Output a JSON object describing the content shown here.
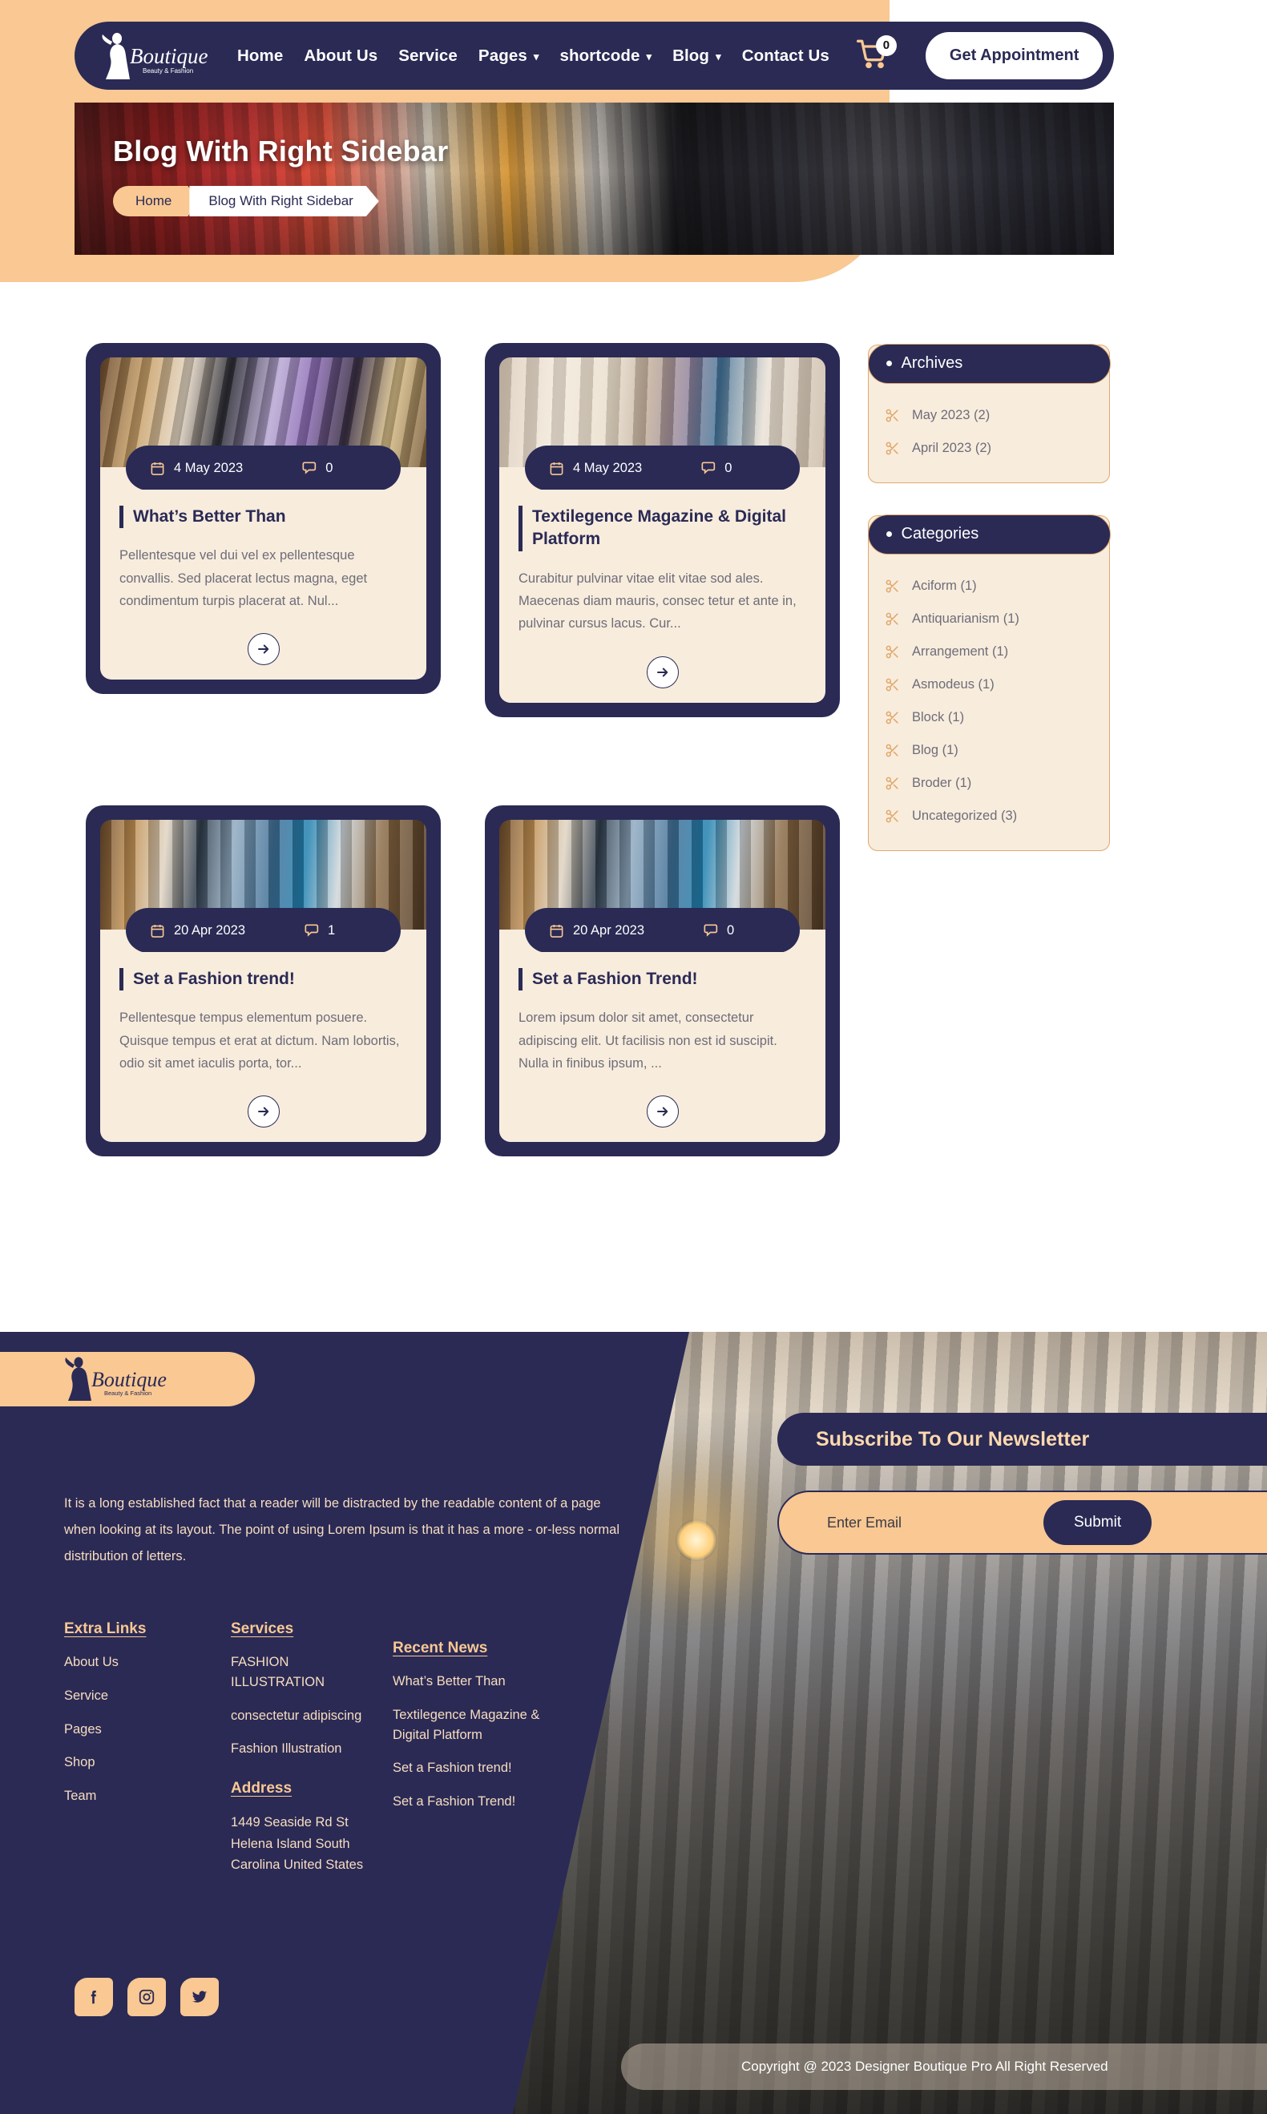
{
  "nav": {
    "brand": "Boutique",
    "brand_tagline": "Beauty & Fashion",
    "links": [
      {
        "label": "Home",
        "caret": false
      },
      {
        "label": "About Us",
        "caret": false
      },
      {
        "label": "Service",
        "caret": false
      },
      {
        "label": "Pages",
        "caret": true
      },
      {
        "label": "shortcode",
        "caret": true
      },
      {
        "label": "Blog",
        "caret": true
      },
      {
        "label": "Contact Us",
        "caret": false
      }
    ],
    "cart_count": "0",
    "cta": "Get Appointment"
  },
  "hero": {
    "title": "Blog With Right Sidebar",
    "crumb_home": "Home",
    "crumb_current": "Blog With Right Sidebar"
  },
  "posts": [
    {
      "date": "4 May 2023",
      "comments": "0",
      "title": "What’s Better Than",
      "excerpt": "Pellentesque vel dui vel ex pellentesque convallis. Sed placerat lectus magna, eget condimentum turpis placerat at. Nul..."
    },
    {
      "date": "4 May 2023",
      "comments": "0",
      "title": "Textilegence Magazine & Digital Platform",
      "excerpt": "Curabitur pulvinar vitae elit vitae sod ales. Maecenas diam mauris, consec tetur et ante in, pulvinar cursus lacus. Cur..."
    },
    {
      "date": "20 Apr 2023",
      "comments": "1",
      "title": "Set a Fashion trend!",
      "excerpt": "Pellentesque tempus elementum posuere. Quisque tempus et erat at dictum. Nam lobortis, odio sit amet iaculis porta, tor..."
    },
    {
      "date": "20 Apr 2023",
      "comments": "0",
      "title": "Set a Fashion Trend!",
      "excerpt": "Lorem ipsum dolor sit amet, consectetur adipiscing elit. Ut facilisis non est id suscipit. Nulla in finibus ipsum, ..."
    }
  ],
  "sidebar": {
    "archives": {
      "title": "Archives",
      "items": [
        {
          "label": "May 2023 (2)"
        },
        {
          "label": "April 2023 (2)"
        }
      ]
    },
    "categories": {
      "title": "Categories",
      "items": [
        {
          "label": "Aciform (1)"
        },
        {
          "label": "Antiquarianism (1)"
        },
        {
          "label": "Arrangement (1)"
        },
        {
          "label": "Asmodeus (1)"
        },
        {
          "label": "Block (1)"
        },
        {
          "label": "Blog (1)"
        },
        {
          "label": "Broder (1)"
        },
        {
          "label": "Uncategorized (3)"
        }
      ]
    }
  },
  "footer": {
    "brand": "Boutique",
    "brand_tagline": "Beauty & Fashion",
    "description": "It is a long established fact that a reader will be distracted by the readable content of a page when looking at its layout. The point of using Lorem Ipsum is that it has a more - or-less normal distribution of letters.",
    "extra_links": {
      "title": "Extra Links",
      "items": [
        "About Us",
        "Service",
        "Pages",
        "Shop",
        "Team"
      ]
    },
    "services": {
      "title": "Services",
      "items": [
        "FASHION ILLUSTRATION",
        "consectetur adipiscing",
        "Fashion Illustration"
      ]
    },
    "address": {
      "title": "Address",
      "text": "1449 Seaside Rd St Helena Island South Carolina United States"
    },
    "recent_news": {
      "title": "Recent News",
      "items": [
        "What’s Better Than",
        "Textilegence Magazine & Digital Platform",
        "Set a Fashion trend!",
        "Set a Fashion Trend!"
      ]
    },
    "socials": [
      "facebook-icon",
      "instagram-icon",
      "twitter-icon"
    ],
    "copyright": "Copyright @ 2023 Designer Boutique Pro All Right Reserved"
  },
  "newsletter": {
    "title": "Subscribe To Our Newsletter",
    "placeholder": "Enter Email",
    "value": "",
    "submit": "Submit"
  },
  "colors": {
    "navy": "#2a2a55",
    "peach": "#f9c893",
    "cream": "#f8ecdd",
    "orange": "#e0a96d"
  }
}
